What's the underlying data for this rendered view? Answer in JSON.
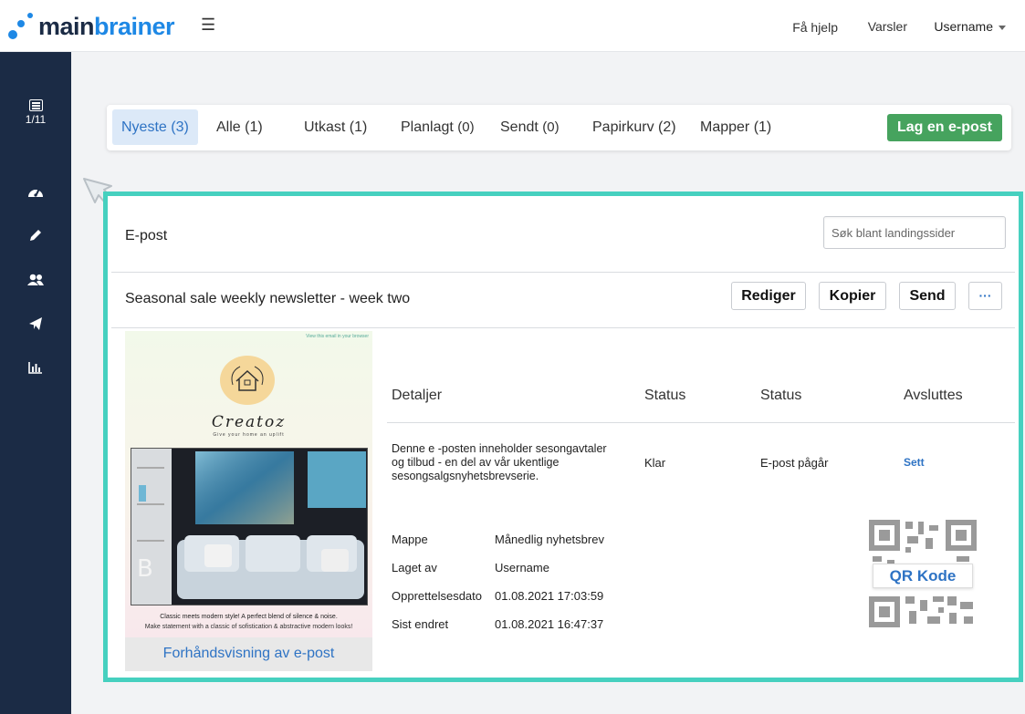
{
  "app": {
    "logo_text_dark": "main",
    "logo_text_blue": "brainer"
  },
  "topnav": {
    "help": "Få hjelp",
    "alerts": "Varsler",
    "user": "Username"
  },
  "sidebar": {
    "counter": "1/11",
    "items": [
      {
        "icon": "dashboard-icon"
      },
      {
        "icon": "pencil-icon"
      },
      {
        "icon": "users-icon"
      },
      {
        "icon": "paper-plane-icon"
      },
      {
        "icon": "bar-chart-icon"
      }
    ]
  },
  "tabs": [
    {
      "label": "Nyeste",
      "count": "(3)"
    },
    {
      "label": "Alle",
      "count": "(1)"
    },
    {
      "label": "Utkast",
      "count": "(1)"
    },
    {
      "label": "Planlagt",
      "count": "(0)"
    },
    {
      "label": "Sendt",
      "count": "(0)"
    },
    {
      "label": "Papirkurv",
      "count": "(2)"
    },
    {
      "label": "Mapper",
      "count": "(1)"
    }
  ],
  "create_button": "Lag en e-post",
  "panel": {
    "title": "E-post",
    "search_placeholder": "Søk blant landingssider"
  },
  "item": {
    "title": "Seasonal sale weekly newsletter - week two",
    "actions": {
      "edit": "Rediger",
      "copy": "Kopier",
      "send": "Send",
      "more": "···"
    },
    "preview": {
      "top_link": "View this email in your browser",
      "brand": "Creatoz",
      "tagline": "Give your home an uplift",
      "caption1": "Classic meets modern style! A perfect blend of silence & noise.",
      "caption2": "Make statement with a classic of sofistication & abstractive modern looks!",
      "link": "Forhåndsvisning av e-post"
    },
    "table": {
      "headers": [
        "Detaljer",
        "Status",
        "Status",
        "Avsluttes"
      ],
      "description": "Denne e -posten inneholder sesongavtaler og tilbud - en del av vår ukentlige sesongsalgsnyhetsbrevserie.",
      "status1": "Klar",
      "status2": "E-post pågår",
      "ends": "Sett"
    },
    "meta": {
      "folder_label": "Mappe",
      "folder_value": "Månedlig nyhetsbrev",
      "created_by_label": "Laget av",
      "created_by_value": "Username",
      "created_label": "Opprettelsesdato",
      "created_value": "01.08.2021 17:03:59",
      "modified_label": "Sist endret",
      "modified_value": "01.08.2021 16:47:37"
    },
    "qr_label": "QR Kode"
  },
  "colors": {
    "accent": "#2e73c4",
    "sidebar": "#1b2b45",
    "create": "#46a35e",
    "highlight": "#46d0bf"
  }
}
